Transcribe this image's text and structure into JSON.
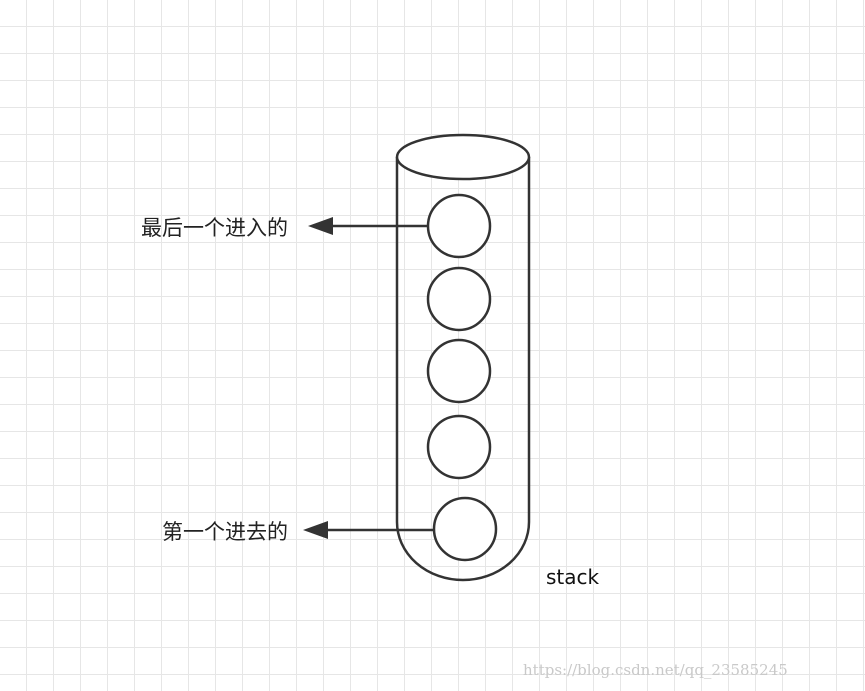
{
  "labels": {
    "last_in": "最后一个进入的",
    "first_in": "第一个进去的",
    "container": "stack"
  },
  "watermark": "https://blog.csdn.net/qq_23585245",
  "stack": {
    "element_count": 5
  },
  "colors": {
    "stroke": "#333333",
    "grid": "#e6e6e6",
    "text": "#222222",
    "watermark": "#c9c9c9"
  }
}
